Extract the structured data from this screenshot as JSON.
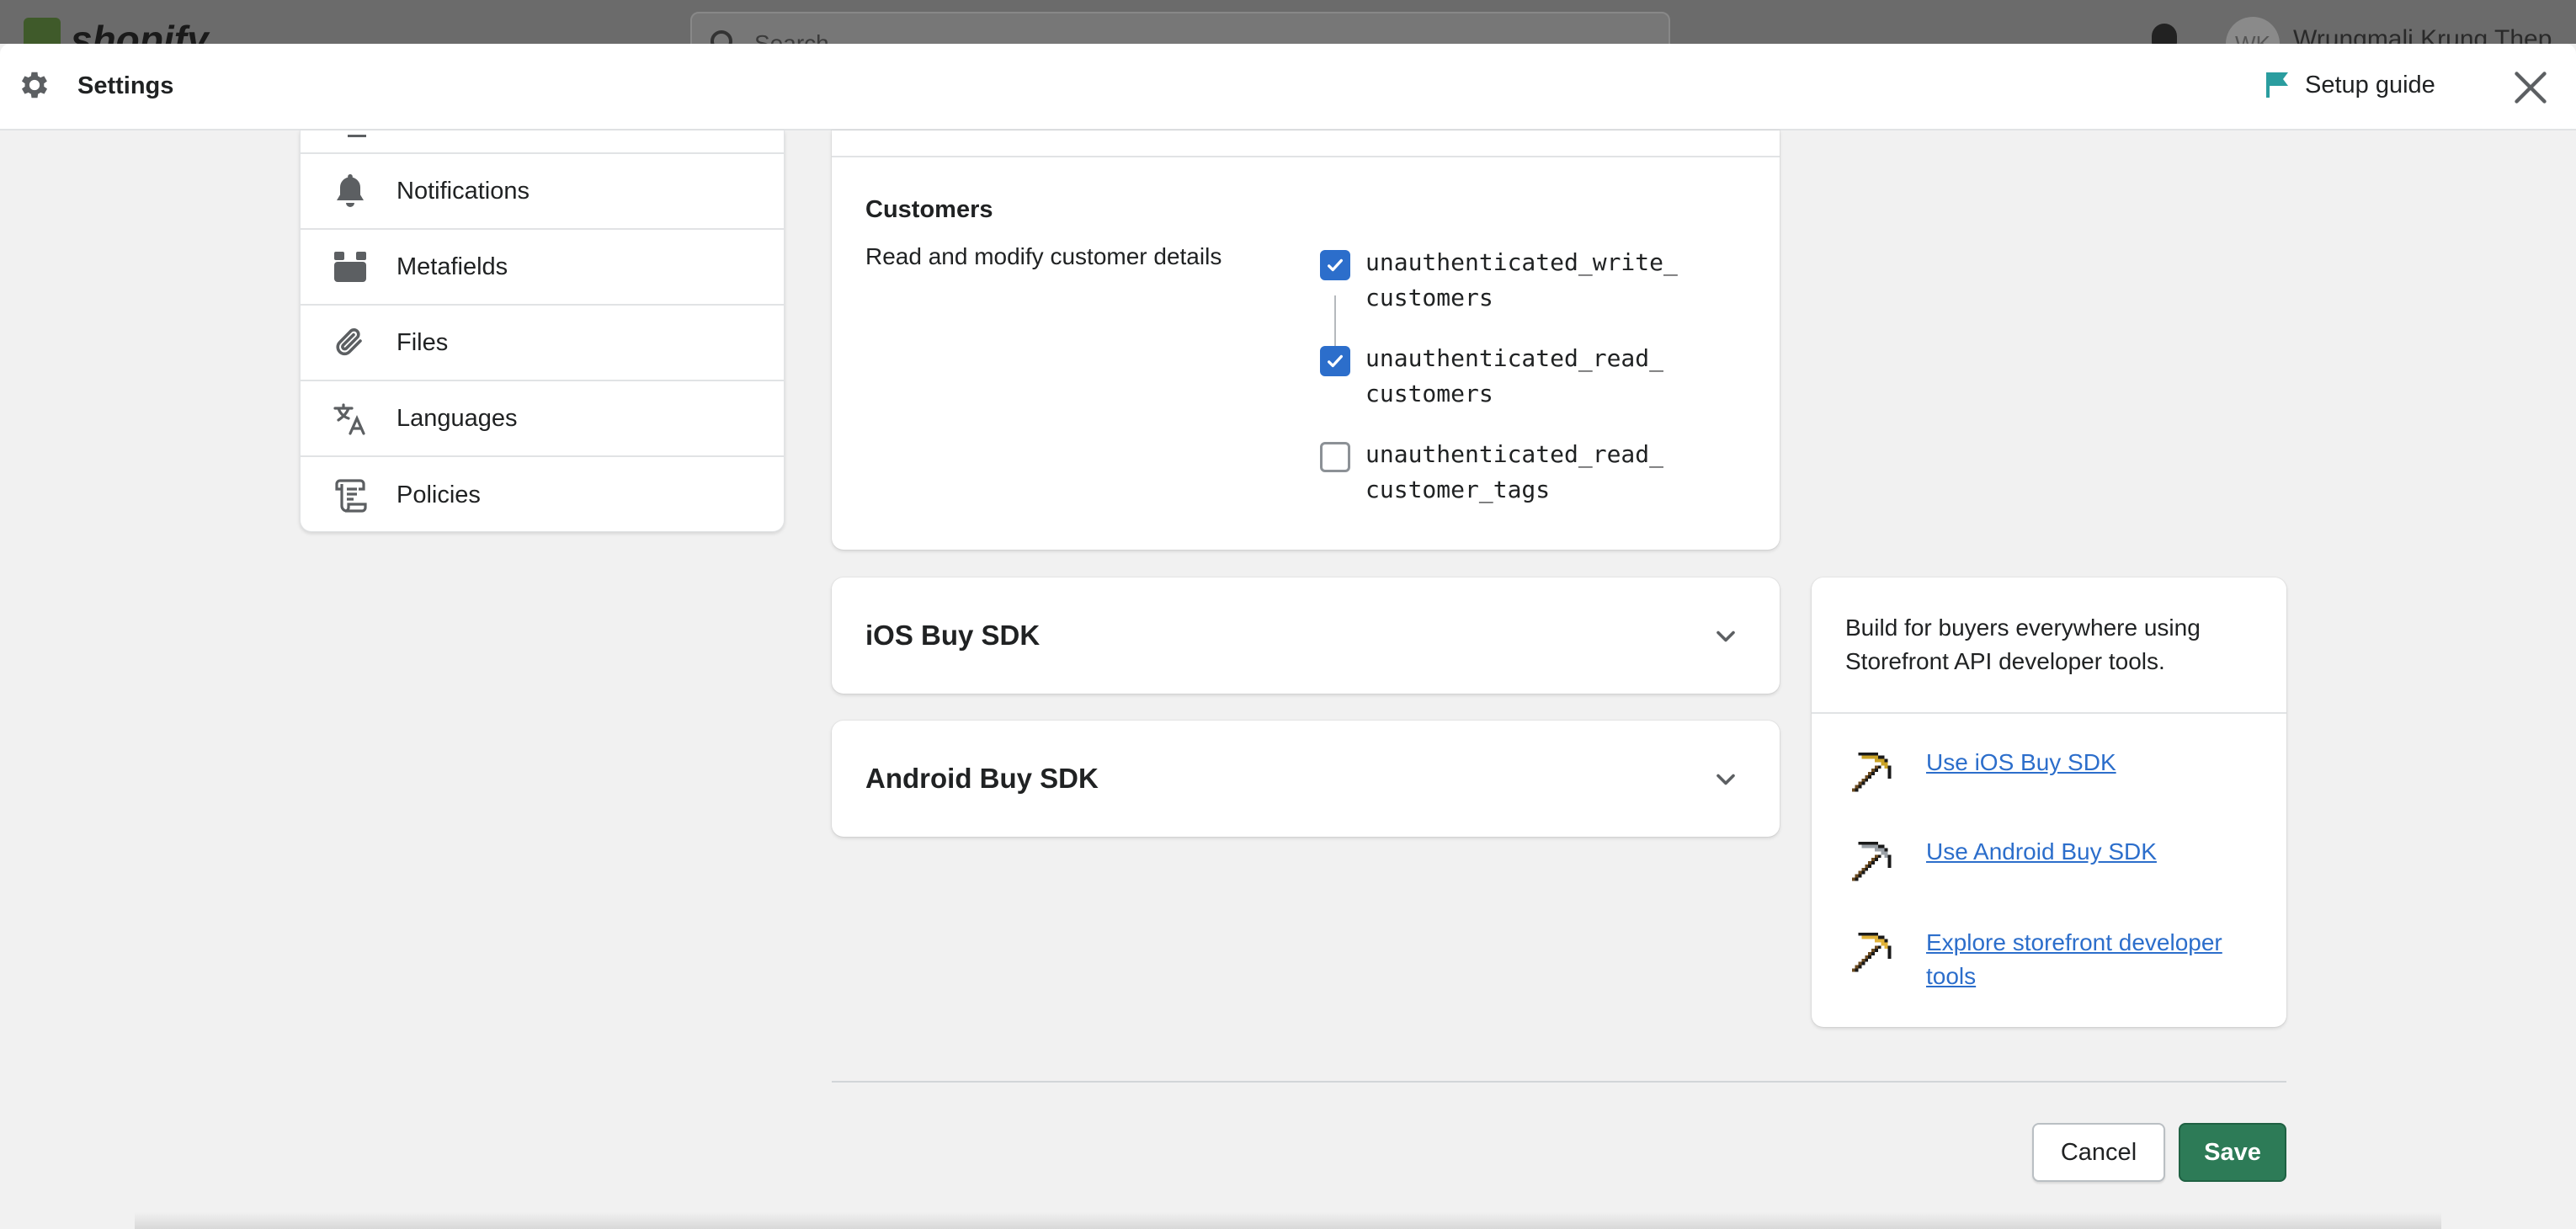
{
  "topbar": {
    "logo_text": "shopify",
    "search_placeholder": "Search",
    "user_initials": "WK",
    "user_name": "Wrungmali Krung Thep"
  },
  "modal": {
    "title": "Settings",
    "setup_guide_label": "Setup guide"
  },
  "sidebar": {
    "items": [
      {
        "label": "Notifications",
        "icon": "bell-icon"
      },
      {
        "label": "Metafields",
        "icon": "metafields-icon"
      },
      {
        "label": "Files",
        "icon": "paperclip-icon"
      },
      {
        "label": "Languages",
        "icon": "translate-icon"
      },
      {
        "label": "Policies",
        "icon": "policy-document-icon"
      }
    ]
  },
  "customers": {
    "heading": "Customers",
    "description": "Read and modify customer details",
    "permissions": [
      {
        "label": "unauthenticated_write_\ncustomers",
        "checked": true
      },
      {
        "label": "unauthenticated_read_\ncustomers",
        "checked": true
      },
      {
        "label": "unauthenticated_read_\ncustomer_tags",
        "checked": false
      }
    ]
  },
  "sdks": [
    {
      "title": "iOS Buy SDK"
    },
    {
      "title": "Android Buy SDK"
    }
  ],
  "tools": {
    "intro": "Build for buyers everywhere using Storefront API developer tools.",
    "links": [
      {
        "label": "Use iOS Buy SDK",
        "icon": "pickaxe-gold-icon"
      },
      {
        "label": "Use Android Buy SDK",
        "icon": "pickaxe-gray-icon"
      },
      {
        "label": "Explore storefront developer tools",
        "icon": "pickaxe-gold-icon"
      }
    ]
  },
  "footer": {
    "cancel_label": "Cancel",
    "save_label": "Save"
  },
  "colors": {
    "accent_blue": "#2c6ecb",
    "save_green": "#2d7b57",
    "setup_flag": "#2a9d9f"
  }
}
